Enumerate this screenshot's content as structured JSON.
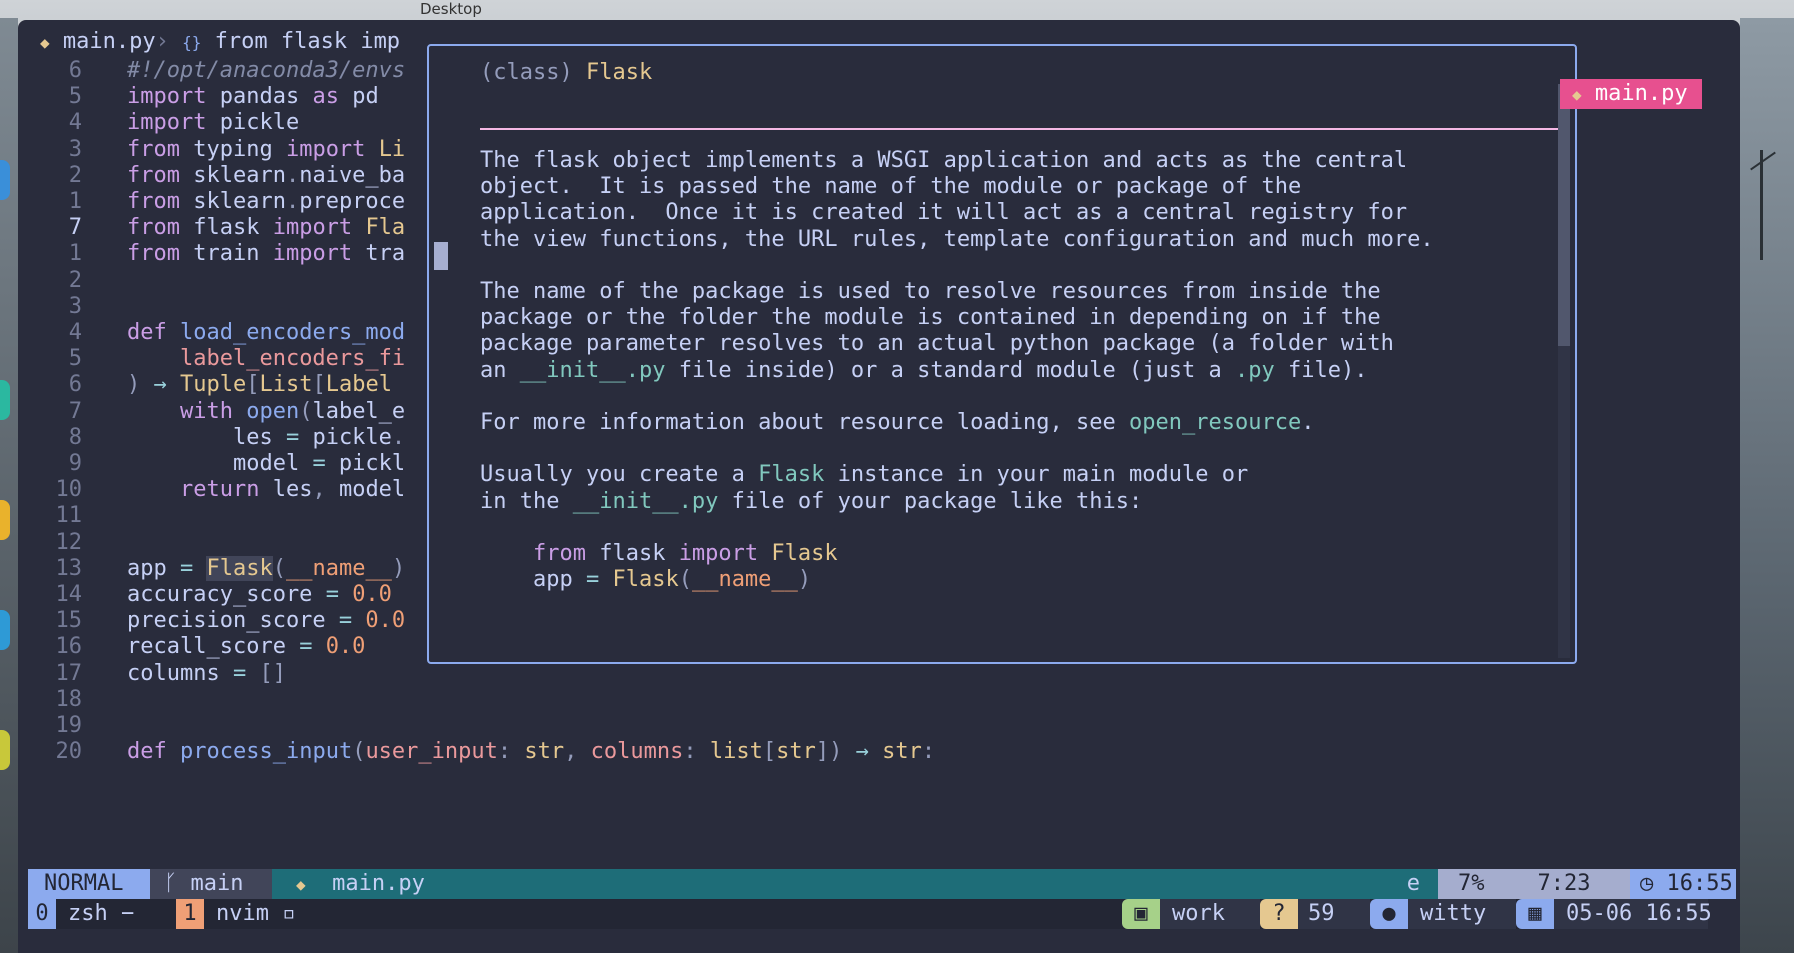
{
  "desktop": {
    "label": "Desktop"
  },
  "breadcrumb": {
    "file": "main.py",
    "symbol": "from flask imp"
  },
  "code_lines": [
    {
      "num": "6",
      "html": "<span class='cm'>#!/opt/anaconda3/envs</span>"
    },
    {
      "num": "5",
      "html": "<span class='k'>import</span> pandas <span class='k'>as</span> pd"
    },
    {
      "num": "4",
      "html": "<span class='k'>import</span> pickle"
    },
    {
      "num": "3",
      "html": "<span class='k'>from</span> typing <span class='k'>import</span> <span class='t'>Li</span>"
    },
    {
      "num": "2",
      "html": "<span class='k'>from</span> sklearn<span class='g'>.</span>naive_ba"
    },
    {
      "num": "1",
      "html": "<span class='k'>from</span> sklearn<span class='g'>.</span>preproce"
    },
    {
      "num": "7",
      "current": true,
      "html": "<span class='k'>from</span> flask <span class='k'>import</span> <span class='t'>Fla</span>"
    },
    {
      "num": "1",
      "html": "<span class='k'>from</span> train <span class='k'>import</span> tra"
    },
    {
      "num": "2",
      "html": ""
    },
    {
      "num": "3",
      "html": ""
    },
    {
      "num": "4",
      "html": "<span class='k'>def</span> <span class='f'>load_encoders_mod</span>"
    },
    {
      "num": "5",
      "html": "    <span class='p'>label_encoders_fi</span>"
    },
    {
      "num": "6",
      "html": "<span class='g'>)</span> <span class='op'>→</span> <span class='t'>Tuple</span><span class='g'>[</span><span class='t'>List</span><span class='g'>[</span><span class='t'>Label</span>"
    },
    {
      "num": "7",
      "html": "    <span class='k'>with</span> <span class='f'>open</span><span class='g'>(</span>label_e"
    },
    {
      "num": "8",
      "html": "        les <span class='op'>=</span> pickle<span class='g'>.</span>"
    },
    {
      "num": "9",
      "html": "        model <span class='op'>=</span> pickl"
    },
    {
      "num": "10",
      "html": "    <span class='k'>return</span> les<span class='g'>,</span> model"
    },
    {
      "num": "11",
      "html": ""
    },
    {
      "num": "12",
      "html": ""
    },
    {
      "num": "13",
      "html": "app <span class='op'>=</span> <span class='t hl'>Flask</span><span class='g'>(</span><span class='n'>__name__</span><span class='g'>)</span>"
    },
    {
      "num": "14",
      "html": "accuracy_score <span class='op'>=</span> <span class='n'>0.0</span>"
    },
    {
      "num": "15",
      "html": "precision_score <span class='op'>=</span> <span class='n'>0.0</span>"
    },
    {
      "num": "16",
      "html": "recall_score <span class='op'>=</span> <span class='n'>0.0</span>"
    },
    {
      "num": "17",
      "html": "columns <span class='op'>=</span> <span class='g'>[]</span>"
    },
    {
      "num": "18",
      "html": ""
    },
    {
      "num": "19",
      "html": ""
    },
    {
      "num": "20",
      "html": "<span class='k'>def</span> <span class='f'>process_input</span><span class='g'>(</span><span class='p'>user_input</span><span class='g'>:</span> <span class='t'>str</span><span class='g'>,</span> <span class='p'>columns</span><span class='g'>:</span> <span class='t'>list</span><span class='g'>[</span><span class='t'>str</span><span class='g'>])</span> <span class='op'>→</span> <span class='t'>str</span><span class='g'>:</span>"
    }
  ],
  "hover_doc": {
    "header_html": "<span class='g'>(class)</span> <span class='t'>Flask</span>",
    "lines": [
      "The flask object implements a WSGI application and acts as the central",
      "object.  It is passed the name of the module or package of the",
      "application.  Once it is created it will act as a central registry for",
      "the view functions, the URL rules, template configuration and much more.",
      "",
      "The name of the package is used to resolve resources from inside the",
      "package or the folder the module is contained in depending on if the",
      "package parameter resolves to an actual python package (a folder with",
      "an <span class='ac'>__init__.py</span> file inside) or a standard module (just a <span class='ac'>.py</span> file).",
      "",
      "For more information about resource loading, see <span class='ac'>open_resource</span>.",
      "",
      "Usually you create a <span class='ac'>Flask</span> instance in your main module or",
      "in the <span class='ac'>__init__.py</span> file of your package like this:",
      "",
      "    <span class='k'>from</span> flask <span class='k'>import</span> <span class='t'>Flask</span>",
      "    app <span class='op'>=</span> <span class='t'>Flask</span><span class='g'>(</span><span class='n'>__name__</span><span class='g'>)</span>"
    ]
  },
  "tab_badge": {
    "label": "main.py"
  },
  "statusline": {
    "mode": "NORMAL",
    "branch": "main",
    "filename": "main.py",
    "encoding": "e",
    "percent": "7%",
    "position": "7:23",
    "time": "16:55"
  },
  "tmux": {
    "win0_index": "0",
    "win0_name": "zsh −",
    "win1_index": "1",
    "win1_name": "nvim ▫",
    "session": "work",
    "help_count": "59",
    "user": "witty",
    "datetime": "05-06 16:55"
  },
  "colors": {
    "accent": "#8caaee",
    "badge": "#e7508f",
    "editor_bg": "#292c3c"
  }
}
